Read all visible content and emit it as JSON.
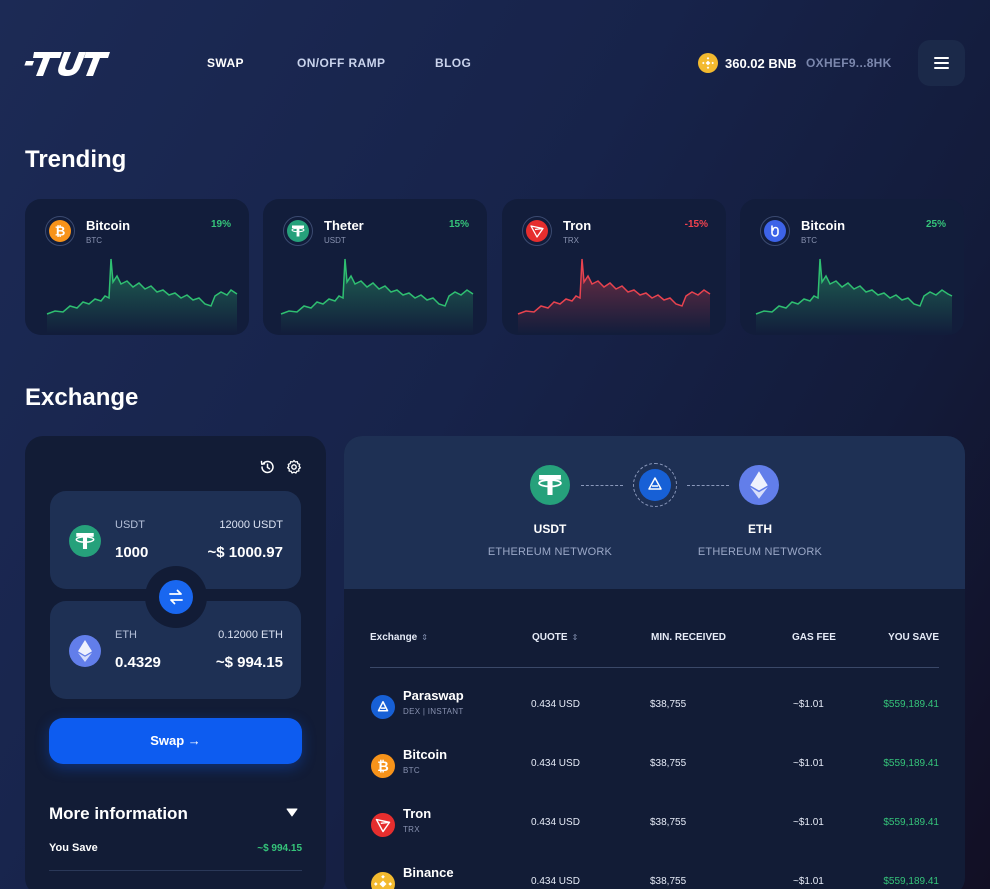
{
  "nav": {
    "links": [
      "SWAP",
      "ON/OFF RAMP",
      "BLOG"
    ],
    "balance": "360.02 BNB",
    "address": "OXHEF9...8HK"
  },
  "trending": {
    "title": "Trending",
    "cards": [
      {
        "name": "Bitcoin",
        "symbol": "BTC",
        "change": "19%",
        "icon": "bitcoin-icon",
        "trend": "up"
      },
      {
        "name": "Theter",
        "symbol": "USDT",
        "change": "15%",
        "icon": "tether-icon",
        "trend": "up"
      },
      {
        "name": "Tron",
        "symbol": "TRX",
        "change": "-15%",
        "icon": "tron-icon",
        "trend": "down"
      },
      {
        "name": "Bitcoin",
        "symbol": "BTC",
        "change": "25%",
        "icon": "chainlink-icon",
        "trend": "up"
      }
    ]
  },
  "exchange": {
    "title": "Exchange",
    "from": {
      "symbol": "USDT",
      "balance": "12000 USDT",
      "amount": "1000",
      "value": "~$ 1000.97"
    },
    "to": {
      "symbol": "ETH",
      "balance": "0.12000 ETH",
      "amount": "0.4329",
      "value": "~$ 994.15"
    },
    "swap_label": "Swap →",
    "more_info": "More information",
    "you_save_label": "You Save",
    "you_save_value": "~$ 994.15"
  },
  "route": {
    "from_symbol": "USDT",
    "from_network": "ETHEREUM NETWORK",
    "to_symbol": "ETH",
    "to_network": "ETHEREUM NETWORK",
    "headers": [
      "Exchange",
      "QUOTE",
      "MIN. RECEIVED",
      "GAS FEE",
      "YOU SAVE"
    ],
    "rows": [
      {
        "name": "Paraswap",
        "sub": "DEX | INSTANT",
        "quote": "0.434 USD",
        "min": "$38,755",
        "gas": "~$1.01",
        "save": "$559,189.41",
        "icon": "paraswap-icon"
      },
      {
        "name": "Bitcoin",
        "sub": "BTC",
        "quote": "0.434 USD",
        "min": "$38,755",
        "gas": "~$1.01",
        "save": "$559,189.41",
        "icon": "bitcoin-icon"
      },
      {
        "name": "Tron",
        "sub": "TRX",
        "quote": "0.434 USD",
        "min": "$38,755",
        "gas": "~$1.01",
        "save": "$559,189.41",
        "icon": "tron-icon"
      },
      {
        "name": "Binance",
        "sub": "",
        "quote": "0.434 USD",
        "min": "$38,755",
        "gas": "~$1.01",
        "save": "$559,189.41",
        "icon": "binance-icon"
      }
    ]
  },
  "colors": {
    "accent": "#0d5cf0",
    "positive": "#35c47a",
    "negative": "#f0434f"
  }
}
